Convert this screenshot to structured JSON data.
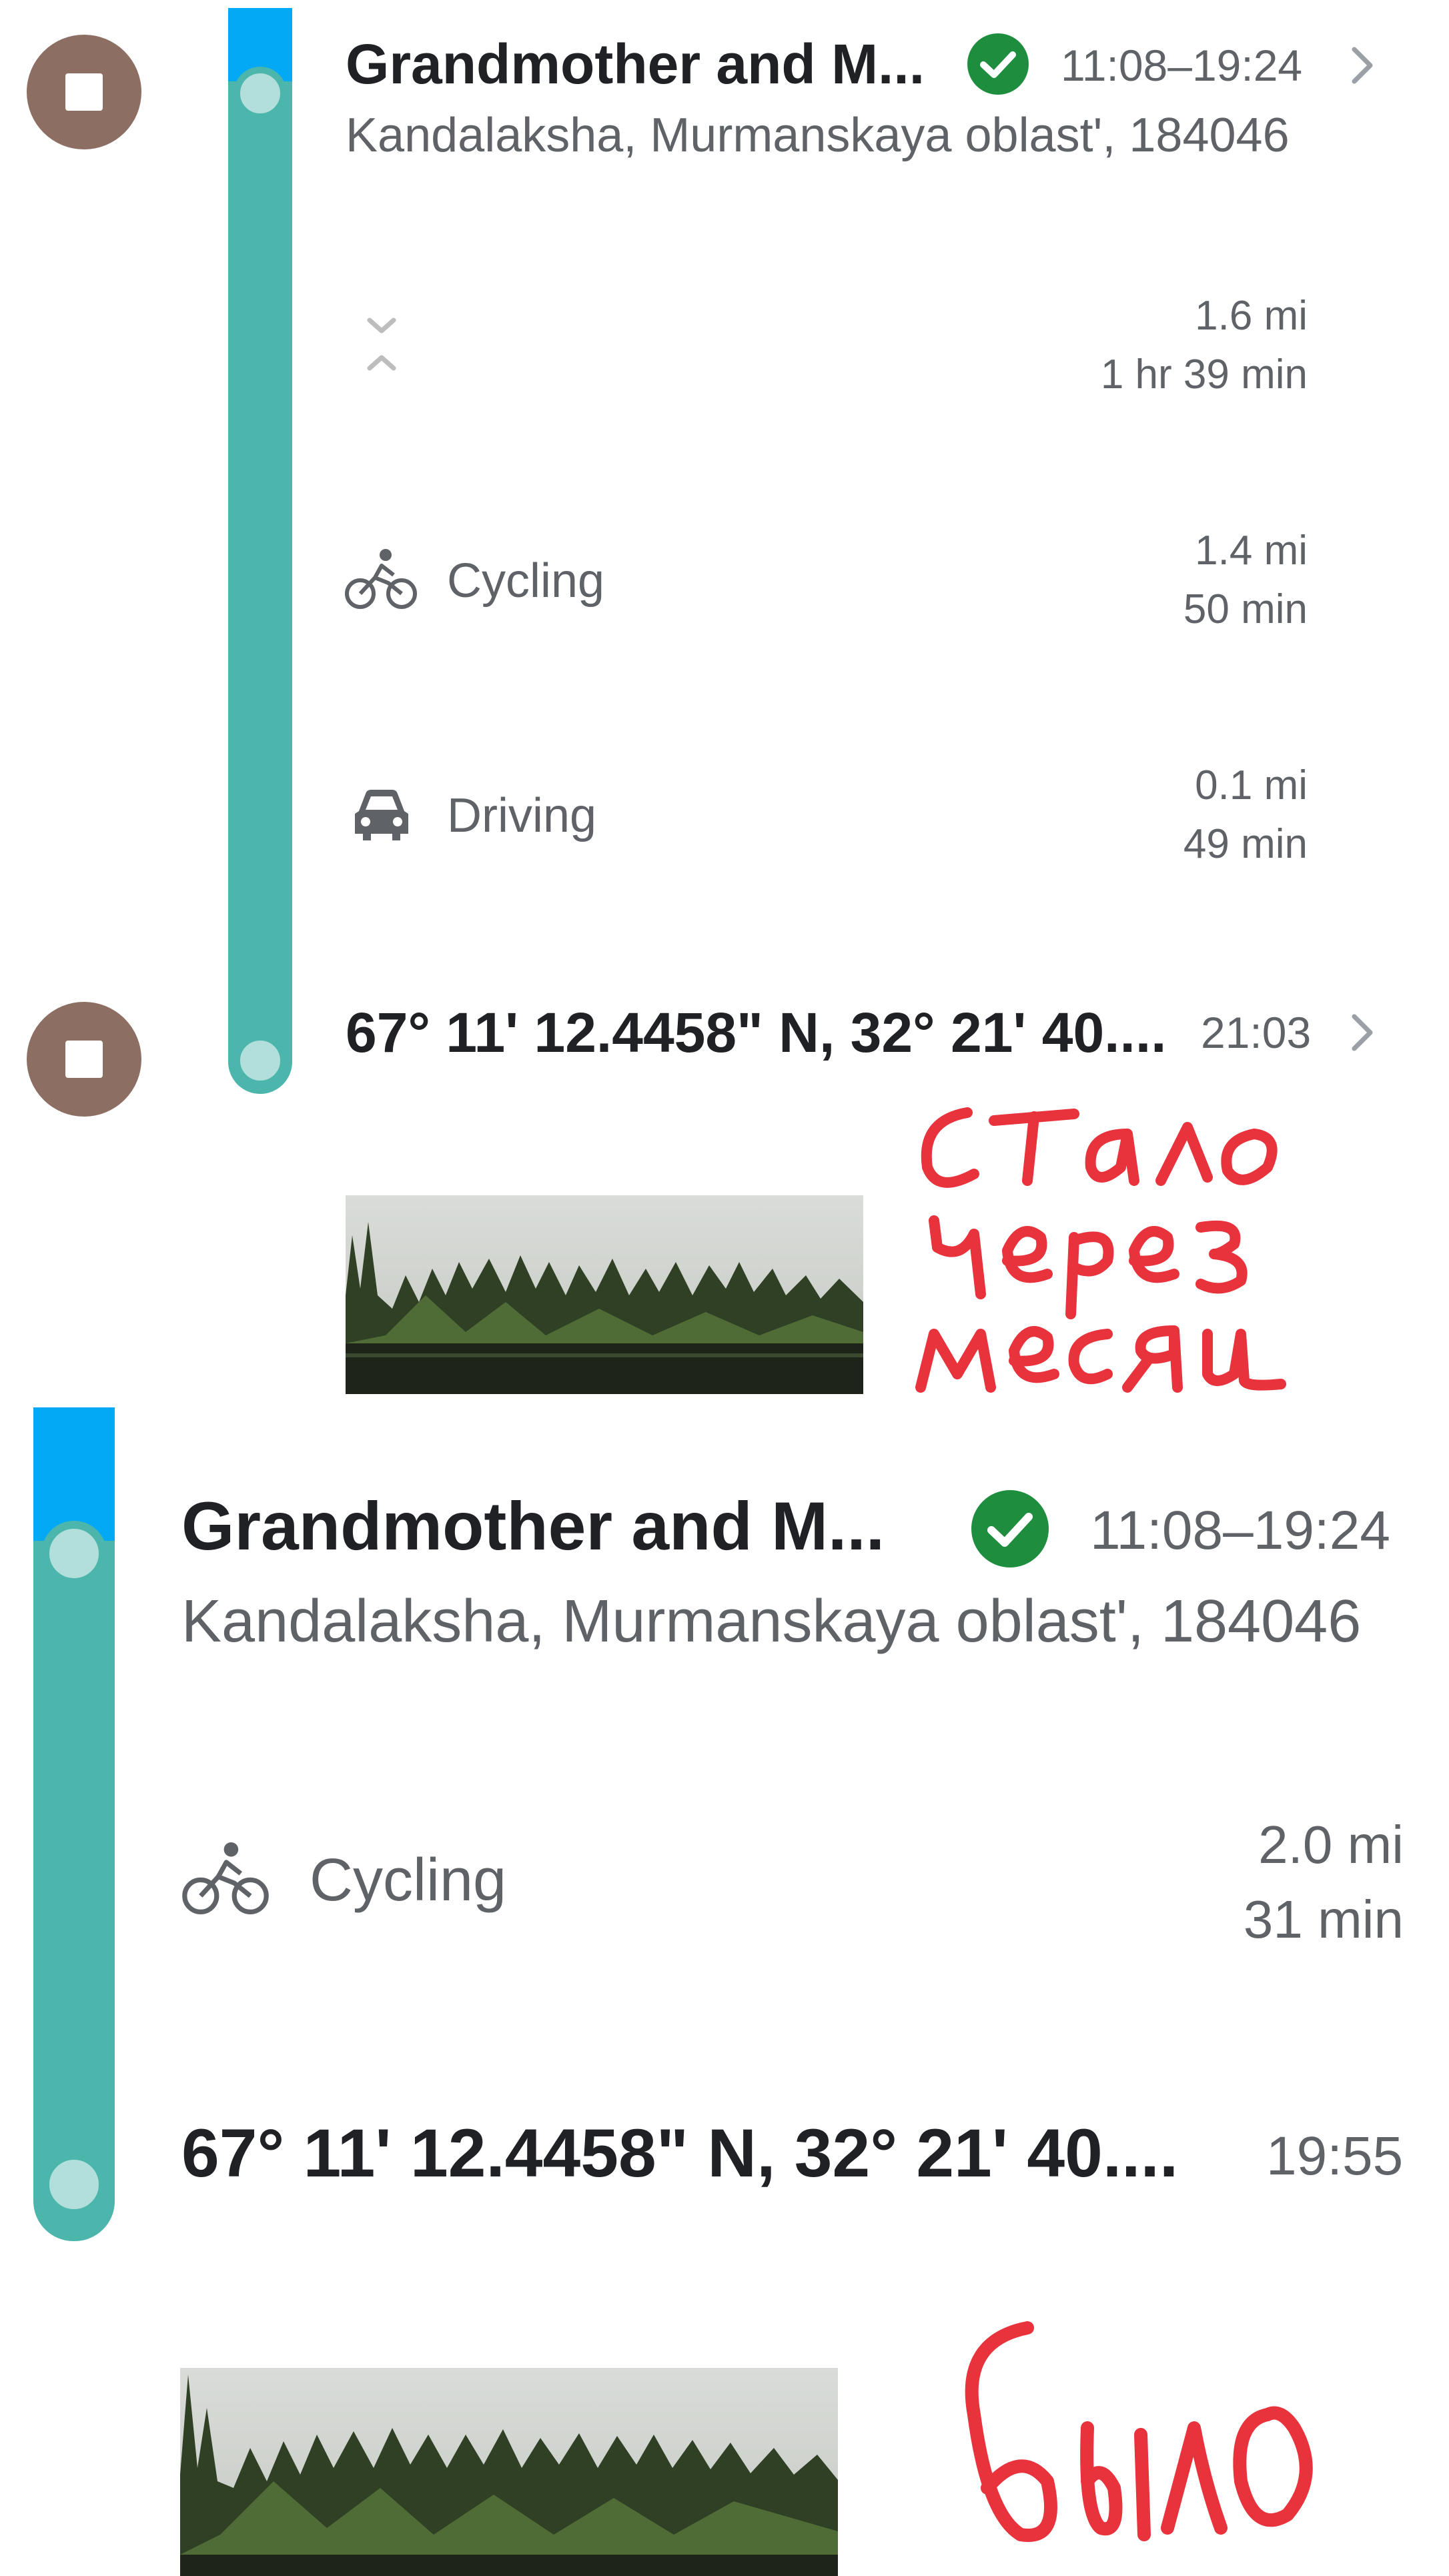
{
  "top": {
    "visit": {
      "place_name": "Grandmother and M...",
      "address": "Kandalaksha, Murmanskaya oblast', 184046",
      "time_range": "11:08–19:24"
    },
    "segments": [
      {
        "label": "",
        "icon": "expand-collapse-icon",
        "distance": "1.6 mi",
        "duration": "1 hr 39 min"
      },
      {
        "label": "Cycling",
        "icon": "bicycle-icon",
        "distance": "1.4 mi",
        "duration": "50 min"
      },
      {
        "label": "Driving",
        "icon": "car-icon",
        "distance": "0.1 mi",
        "duration": "49 min"
      }
    ],
    "destination": {
      "coords": "67° 11' 12.4458\" N, 32° 21' 40....",
      "time": "21:03"
    },
    "handwritten_note": "стало через месяц"
  },
  "bottom": {
    "visit": {
      "place_name": "Grandmother and M...",
      "address": "Kandalaksha, Murmanskaya oblast', 184046",
      "time_range": "11:08–19:24"
    },
    "segments": [
      {
        "label": "Cycling",
        "icon": "bicycle-icon",
        "distance": "2.0 mi",
        "duration": "31 min"
      }
    ],
    "destination": {
      "coords": "67° 11' 12.4458\" N, 32° 21' 40....",
      "time": "19:55"
    },
    "handwritten_note": "было"
  },
  "colors": {
    "timeline_teal": "#4db6ac",
    "timeline_blue": "#03a9f4",
    "stop_brown": "#8d6e63",
    "confirmed_green": "#1e8e3e",
    "handwriting_red": "#e8323c"
  }
}
